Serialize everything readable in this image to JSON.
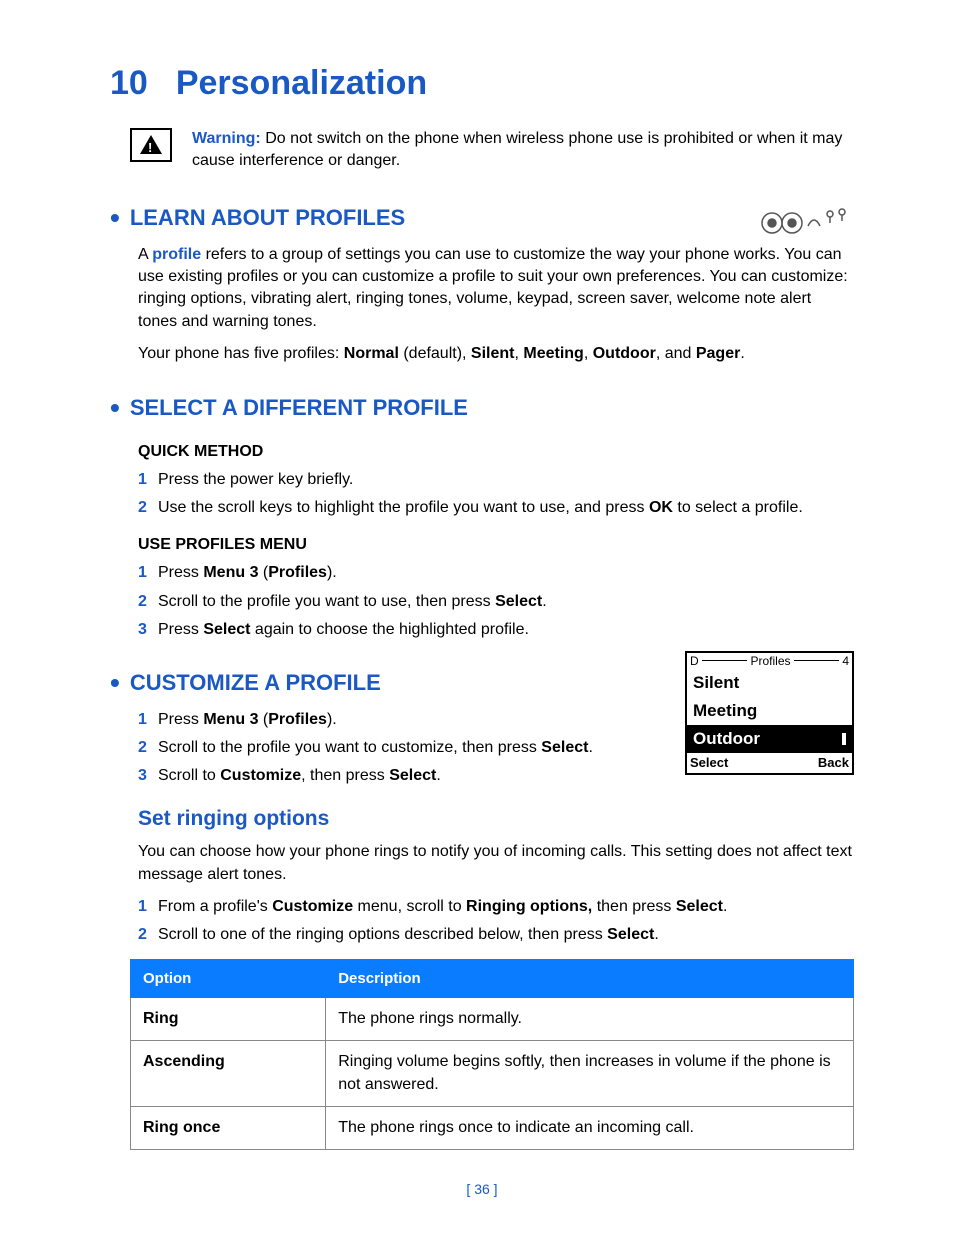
{
  "chapter": {
    "number": "10",
    "title": "Personalization"
  },
  "warning": {
    "label": "Warning:",
    "text": "Do not switch on the phone when wireless phone use is prohibited or when it may cause interference or danger."
  },
  "learn": {
    "heading": "LEARN ABOUT PROFILES",
    "profile_word": "profile",
    "p1a": "A ",
    "p1b": " refers to a group of settings you can use to customize the way your phone works. You can use existing profiles or you can customize a profile to suit your own preferences. You can customize: ringing options, vibrating alert, ringing tones, volume, keypad, screen saver, welcome note alert tones and warning tones.",
    "p2a": "Your phone has five profiles: ",
    "p2_normal": "Normal",
    "p2_default": " (default), ",
    "p2_silent": "Silent",
    "p2_c1": ", ",
    "p2_meeting": "Meeting",
    "p2_c2": ", ",
    "p2_outdoor": "Outdoor",
    "p2_c3": ", and ",
    "p2_pager": "Pager",
    "p2_end": "."
  },
  "select": {
    "heading": "SELECT A DIFFERENT PROFILE",
    "quick": "QUICK METHOD",
    "quick_steps": {
      "s1": "Press the power key briefly.",
      "s2a": "Use the scroll keys to highlight the profile you want to use, and press ",
      "s2_ok": "OK",
      "s2b": " to select a profile."
    },
    "menu": "USE PROFILES MENU",
    "menu_steps": {
      "s1a": "Press ",
      "s1_menu": "Menu 3",
      "s1_paren": " (",
      "s1_prof": "Profiles",
      "s1_end": ").",
      "s2a": "Scroll to the profile you want to use, then press ",
      "s2_sel": "Select",
      "s2b": ".",
      "s3a": "Press ",
      "s3_sel": "Select",
      "s3b": " again to choose the highlighted profile."
    }
  },
  "customize": {
    "heading": "CUSTOMIZE A PROFILE",
    "steps": {
      "s1a": "Press ",
      "s1_menu": "Menu 3",
      "s1_paren": " (",
      "s1_prof": "Profiles",
      "s1_end": ").",
      "s2a": "Scroll to the profile you want to customize, then press ",
      "s2_sel": "Select",
      "s2b": ".",
      "s3a": "Scroll to ",
      "s3_cust": "Customize",
      "s3b": ", then press ",
      "s3_sel": "Select",
      "s3c": "."
    }
  },
  "ringing": {
    "heading": "Set ringing options",
    "intro": "You can choose how your phone rings to notify you of incoming calls. This setting does not affect text message alert tones.",
    "steps": {
      "s1a": "From a profile's ",
      "s1_cust": "Customize",
      "s1b": " menu, scroll to ",
      "s1_ring": "Ringing options,",
      "s1c": " then press ",
      "s1_sel": "Select",
      "s1d": ".",
      "s2a": "Scroll to one of the ringing options described below, then press ",
      "s2_sel": "Select",
      "s2b": "."
    }
  },
  "table": {
    "h1": "Option",
    "h2": "Description",
    "rows": [
      {
        "opt": "Ring",
        "desc": "The phone rings normally."
      },
      {
        "opt": "Ascending",
        "desc": "Ringing volume begins softly, then increases in volume if the phone is not answered."
      },
      {
        "opt": "Ring once",
        "desc": "The phone rings once to indicate an incoming call."
      }
    ]
  },
  "phone_screen": {
    "d": "D",
    "title": "Profiles",
    "num": "4",
    "r1": "Silent",
    "r2": "Meeting",
    "r3": "Outdoor",
    "left": "Select",
    "right": "Back"
  },
  "page_number": "[ 36 ]"
}
